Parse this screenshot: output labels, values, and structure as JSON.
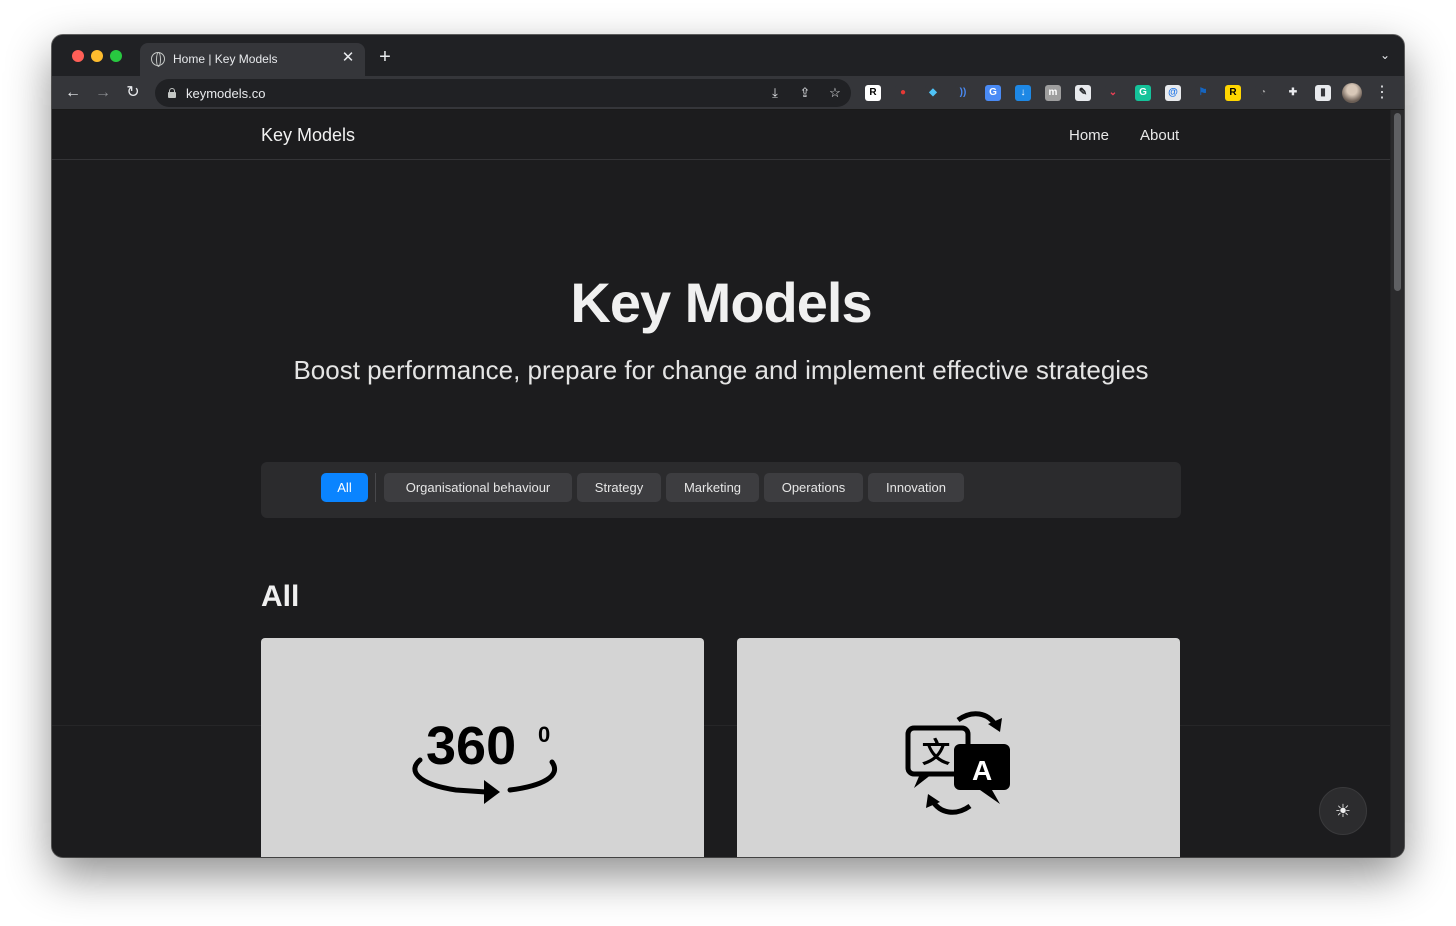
{
  "browser": {
    "tab_title": "Home | Key Models",
    "url": "keymodels.co",
    "tab_close_glyph": "✕",
    "new_tab_glyph": "+",
    "back_glyph": "←",
    "forward_glyph": "→",
    "reload_glyph": "↻",
    "tab_menu_glyph": "⌄",
    "kebab_glyph": "⋮",
    "extensions": [
      {
        "name": "R-extension-icon",
        "glyph": "R",
        "bg": "#ffffff",
        "fg": "#000000"
      },
      {
        "name": "pokeball-extension-icon",
        "glyph": "●",
        "bg": "#35363a",
        "fg": "#e53935"
      },
      {
        "name": "diamond-extension-icon",
        "glyph": "◆",
        "bg": "#35363a",
        "fg": "#4fc3f7"
      },
      {
        "name": "wifi-extension-icon",
        "glyph": "))",
        "bg": "#35363a",
        "fg": "#4a8bf5"
      },
      {
        "name": "google-translate-extension-icon",
        "glyph": "G",
        "bg": "#4a8bf5",
        "fg": "#ffffff"
      },
      {
        "name": "download-extension-icon",
        "glyph": "↓",
        "bg": "#1e88e5",
        "fg": "#ffffff"
      },
      {
        "name": "m-extension-icon",
        "glyph": "m",
        "bg": "#9e9e9e",
        "fg": "#ffffff"
      },
      {
        "name": "pen-extension-icon",
        "glyph": "✎",
        "bg": "#e8eaed",
        "fg": "#202124"
      },
      {
        "name": "pocket-extension-icon",
        "glyph": "⌄",
        "bg": "#35363a",
        "fg": "#ef4056"
      },
      {
        "name": "grammarly-extension-icon",
        "glyph": "G",
        "bg": "#15c39a",
        "fg": "#ffffff"
      },
      {
        "name": "at-extension-icon",
        "glyph": "@",
        "bg": "#e8eaed",
        "fg": "#1a73e8"
      },
      {
        "name": "flag-extension-icon",
        "glyph": "⚑",
        "bg": "#35363a",
        "fg": "#1565c0"
      },
      {
        "name": "R-yellow-extension-icon",
        "glyph": "R",
        "bg": "#ffd600",
        "fg": "#000000"
      },
      {
        "name": "gauge-extension-icon",
        "glyph": "◔",
        "bg": "#35363a",
        "fg": "#9e9e9e"
      },
      {
        "name": "puzzle-extensions-icon",
        "glyph": "✚",
        "bg": "#35363a",
        "fg": "#e8eaed"
      },
      {
        "name": "side-panel-icon",
        "glyph": "▮",
        "bg": "#e8eaed",
        "fg": "#35363a"
      }
    ]
  },
  "site": {
    "brand": "Key Models",
    "nav": [
      "Home",
      "About"
    ]
  },
  "hero": {
    "title": "Key Models",
    "subtitle": "Boost performance, prepare for change and implement effective strategies"
  },
  "filters": [
    {
      "label": "All",
      "active": true
    },
    {
      "label": "Organisational behaviour",
      "active": false
    },
    {
      "label": "Strategy",
      "active": false
    },
    {
      "label": "Marketing",
      "active": false
    },
    {
      "label": "Operations",
      "active": false
    },
    {
      "label": "Innovation",
      "active": false
    }
  ],
  "section": {
    "title": "All"
  },
  "cards": [
    {
      "icon": "360-degree-icon",
      "icon_text": "360",
      "icon_sup": "0"
    },
    {
      "icon": "translate-icon",
      "icon_glyph_a": "文",
      "icon_glyph_b": "A"
    }
  ],
  "theme_toggle_glyph": "☀",
  "colors": {
    "page_bg": "#1c1c1e",
    "accent": "#0a84ff",
    "card_bg": "#d4d4d4"
  }
}
